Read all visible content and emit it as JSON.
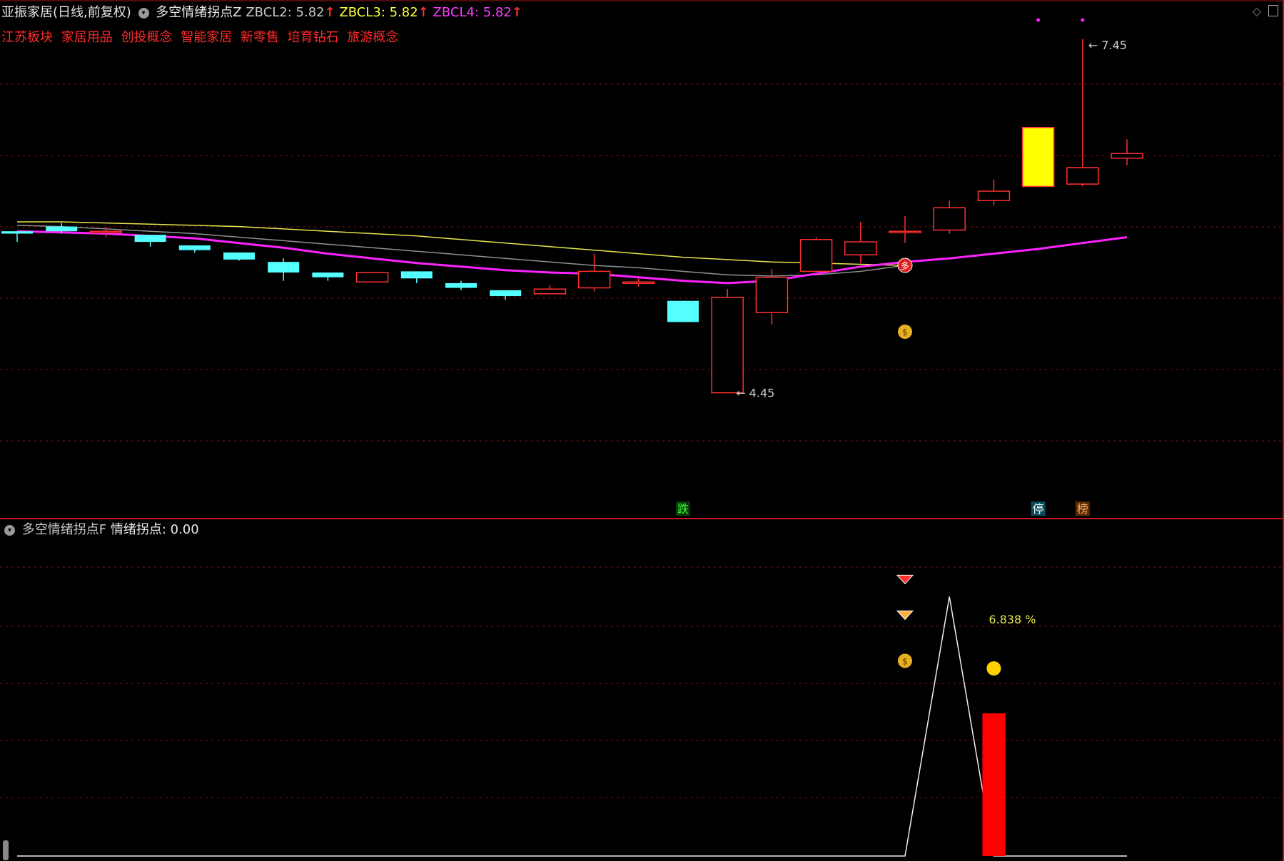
{
  "header": {
    "stock": "亚振家居(日线,前复权)",
    "indicator": "多空情绪拐点Z",
    "zbcl2": "ZBCL2: 5.82",
    "zbcl3": "ZBCL3: 5.82",
    "zbcl4": "ZBCL4: 5.82",
    "arrow": "↑",
    "sectors": [
      "江苏板块",
      "家居用品",
      "创投概念",
      "智能家居",
      "新零售",
      "培育钻石",
      "旅游概念"
    ]
  },
  "lower_header": {
    "indicator": "多空情绪拐点F",
    "label": "情绪拐点: 0.00"
  },
  "colors": {
    "up": "#ff3030",
    "down": "#54ffff",
    "ma_magenta": "#ff22ff",
    "ma_yellow": "#e6e64a",
    "ma_gray": "#909090",
    "grid": "#8a1010",
    "limit_up": "#ffff00",
    "bar": "#ff0000"
  },
  "chart_data": [
    {
      "type": "candlestick",
      "title": "亚振家居(日线,前复权)",
      "candles": [
        {
          "o": 5.82,
          "h": 5.82,
          "l": 5.73,
          "c": 5.8
        },
        {
          "o": 5.86,
          "h": 5.89,
          "l": 5.8,
          "c": 5.82
        },
        {
          "o": 5.82,
          "h": 5.86,
          "l": 5.77,
          "c": 5.82
        },
        {
          "o": 5.79,
          "h": 5.79,
          "l": 5.69,
          "c": 5.73
        },
        {
          "o": 5.7,
          "h": 5.7,
          "l": 5.64,
          "c": 5.66
        },
        {
          "o": 5.64,
          "h": 5.64,
          "l": 5.57,
          "c": 5.58
        },
        {
          "o": 5.56,
          "h": 5.59,
          "l": 5.4,
          "c": 5.47
        },
        {
          "o": 5.47,
          "h": 5.47,
          "l": 5.4,
          "c": 5.43
        },
        {
          "o": 5.39,
          "h": 5.47,
          "l": 5.39,
          "c": 5.47
        },
        {
          "o": 5.48,
          "h": 5.48,
          "l": 5.38,
          "c": 5.42
        },
        {
          "o": 5.38,
          "h": 5.4,
          "l": 5.32,
          "c": 5.34
        },
        {
          "o": 5.32,
          "h": 5.32,
          "l": 5.24,
          "c": 5.27
        },
        {
          "o": 5.29,
          "h": 5.36,
          "l": 5.29,
          "c": 5.33
        },
        {
          "o": 5.34,
          "h": 5.63,
          "l": 5.31,
          "c": 5.48
        },
        {
          "o": 5.39,
          "h": 5.42,
          "l": 5.35,
          "c": 5.39
        },
        {
          "o": 5.23,
          "h": 5.23,
          "l": 5.05,
          "c": 5.05
        },
        {
          "o": 4.45,
          "h": 5.33,
          "l": 4.45,
          "c": 5.26
        },
        {
          "o": 5.13,
          "h": 5.5,
          "l": 5.03,
          "c": 5.43
        },
        {
          "o": 5.48,
          "h": 5.77,
          "l": 5.48,
          "c": 5.75
        },
        {
          "o": 5.62,
          "h": 5.9,
          "l": 5.55,
          "c": 5.73
        },
        {
          "o": 5.82,
          "h": 5.95,
          "l": 5.72,
          "c": 5.82
        },
        {
          "o": 5.83,
          "h": 6.08,
          "l": 5.8,
          "c": 6.02
        },
        {
          "o": 6.08,
          "h": 6.26,
          "l": 6.04,
          "c": 6.16
        },
        {
          "o": 6.2,
          "h": 6.7,
          "l": 6.2,
          "c": 6.7
        },
        {
          "o": 6.22,
          "h": 7.45,
          "l": 6.2,
          "c": 6.36
        },
        {
          "o": 6.44,
          "h": 6.6,
          "l": 6.38,
          "c": 6.48
        }
      ],
      "ma_magenta": [
        5.82,
        5.81,
        5.8,
        5.78,
        5.76,
        5.72,
        5.68,
        5.63,
        5.59,
        5.55,
        5.52,
        5.49,
        5.47,
        5.46,
        5.43,
        5.4,
        5.38,
        5.4,
        5.46,
        5.52,
        5.56,
        5.59,
        5.63,
        5.67,
        5.72,
        5.77
      ],
      "ma_yellow": [
        5.9,
        5.9,
        5.89,
        5.88,
        5.87,
        5.86,
        5.84,
        5.82,
        5.8,
        5.78,
        5.75,
        5.72,
        5.69,
        5.66,
        5.63,
        5.6,
        5.58,
        5.56,
        5.55,
        5.54,
        5.53
      ],
      "ma_gray": [
        5.87,
        5.86,
        5.84,
        5.82,
        5.8,
        5.77,
        5.74,
        5.71,
        5.68,
        5.65,
        5.62,
        5.59,
        5.56,
        5.53,
        5.51,
        5.48,
        5.45,
        5.44,
        5.45,
        5.48,
        5.53
      ],
      "annotations": {
        "high": "7.45",
        "low": "4.45"
      },
      "markers": {
        "die": "跌",
        "ting": "停",
        "bang": "榜",
        "duo": "多"
      },
      "ylim": [
        4.0,
        7.6
      ]
    },
    {
      "type": "line",
      "title": "多空情绪拐点F",
      "line": [
        0,
        0,
        0,
        0,
        0,
        0,
        0,
        0,
        0,
        0,
        0,
        0,
        0,
        0,
        0,
        0,
        0,
        0,
        0,
        0,
        0,
        100,
        0,
        0,
        0,
        0
      ],
      "bar": {
        "index": 22,
        "value": 55
      },
      "label": "6.838 %",
      "ylim": [
        0,
        110
      ]
    }
  ]
}
